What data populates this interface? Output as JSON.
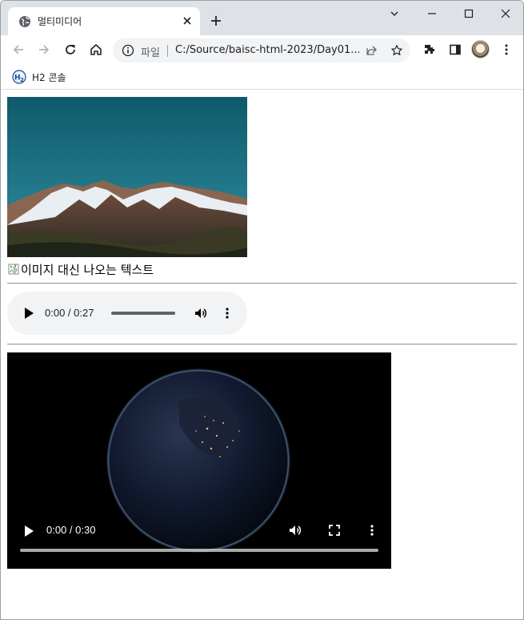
{
  "browser": {
    "tab": {
      "title": "멀티미디어",
      "favicon": "globe-icon"
    },
    "window_controls": [
      "chevron-down-icon",
      "minimize-icon",
      "maximize-icon",
      "close-icon"
    ],
    "omnibox": {
      "scheme": "파일",
      "url": "C:/Source/baisc-html-2023/Day01..."
    },
    "bookmarks": [
      {
        "label": "H2 콘솔",
        "icon": "h2-logo-icon"
      }
    ]
  },
  "page": {
    "image_alt": "이미지 대신 나오는 텍스트",
    "audio": {
      "time": "0:00 / 0:27"
    },
    "video": {
      "time": "0:00 / 0:30"
    }
  },
  "colors": {
    "tabstrip": "#dee1e6",
    "omnibox": "#f1f3f4",
    "audio_bg": "#f1f3f4"
  }
}
